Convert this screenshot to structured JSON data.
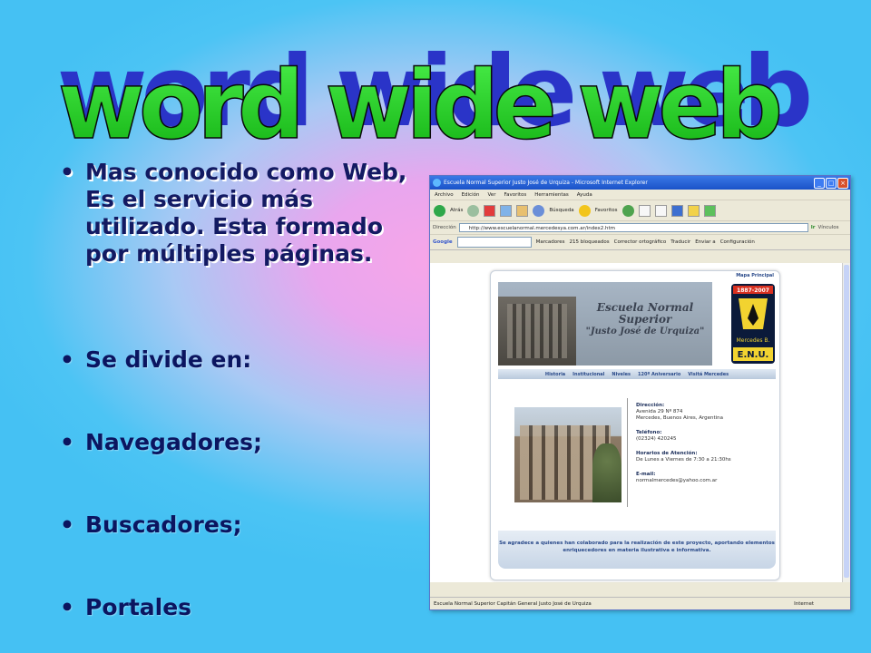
{
  "title": "word wide web",
  "bullets": [
    {
      "text": "Mas conocido como Web, Es el servicio más utilizado. Esta formado por múltiples páginas."
    },
    {
      "text": "Se divide en:"
    },
    {
      "text": "Navegadores;"
    },
    {
      "text": "Buscadores;"
    },
    {
      "text": "Portales"
    }
  ],
  "bullet_glyph": "•",
  "browser": {
    "window_title": "Escuela Normal Superior Justo José de Urquiza - Microsoft Internet Explorer",
    "menu": [
      "Archivo",
      "Edición",
      "Ver",
      "Favoritos",
      "Herramientas",
      "Ayuda"
    ],
    "toolbar": {
      "back": "Atrás",
      "search": "Búsqueda",
      "favorites": "Favoritos"
    },
    "address_label": "Dirección",
    "address": "http://www.escuelanormal.mercedesya.com.ar/index2.htm",
    "go_label": "Ir",
    "links_label": "Vínculos",
    "google_label": "Google",
    "google_items": [
      "Marcadores",
      "215 bloqueados",
      "Corrector ortográfico",
      "Traducir",
      "Enviar a",
      "Configuración"
    ],
    "status_text": "Escuela Normal Superior Capitán General Justo José de Urquiza",
    "status_zone": "Internet"
  },
  "site": {
    "top_links": "Mapa  Principal",
    "banner_text": [
      "Escuela Normal",
      "Superior",
      "\"Justo José de Urquiza\""
    ],
    "logo_years": "1887-2007",
    "logo_text": "E.N.U.",
    "logo_city": "Mercedes B.",
    "nav": [
      "Historia",
      "Institucional",
      "Niveles",
      "120º Aniversario",
      "Visitá Mercedes"
    ],
    "address_title": "Dirección:",
    "address_lines": [
      "Avenida 29 Nº 874",
      "Mercedes, Buenos Aires, Argentina"
    ],
    "phone_title": "Teléfono:",
    "phone": "(02324) 420245",
    "hours_title": "Horarios de Atención:",
    "hours": "De Lunes a Viernes de 7:30 a 21:30hs",
    "email_title": "E-mail:",
    "email": "normalmercedes@yahoo.com.ar",
    "footer": "Se agradece a quienes han colaborado para la realización de este proyecto, aportando elementos enriquecedores en materia ilustrativa e informativa."
  },
  "colors": {
    "title_green": "#22cc22",
    "title_shadow": "#2233cc",
    "bullet_text": "#0b1560"
  }
}
